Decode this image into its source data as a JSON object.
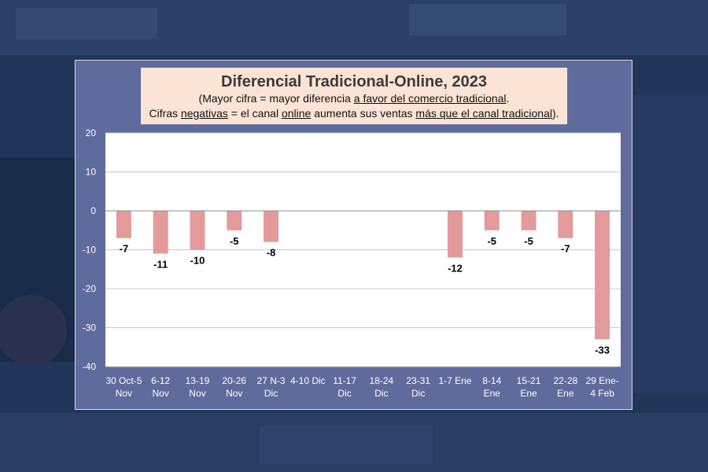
{
  "chart_data": {
    "type": "bar",
    "title": "Diferencial Tradicional-Online, 2023",
    "subtitle_line1": [
      {
        "t": "(Mayor cifra = mayor diferencia ",
        "u": false
      },
      {
        "t": "a favor del comercio tradicional",
        "u": true
      },
      {
        "t": ".",
        "u": false
      }
    ],
    "subtitle_line2": [
      {
        "t": "Cifras ",
        "u": false
      },
      {
        "t": "negativas",
        "u": true
      },
      {
        "t": " = el canal ",
        "u": false
      },
      {
        "t": "online",
        "u": true
      },
      {
        "t": " aumenta sus ventas ",
        "u": false
      },
      {
        "t": "más que el canal tradicional",
        "u": true
      },
      {
        "t": ").",
        "u": false
      }
    ],
    "categories": [
      [
        "30 Oct-5",
        "Nov"
      ],
      [
        "6-12",
        "Nov"
      ],
      [
        "13-19",
        "Nov"
      ],
      [
        "20-26",
        "Nov"
      ],
      [
        "27 N-3",
        "Dic"
      ],
      [
        "4-10 Dic"
      ],
      [
        "11-17",
        "Dic"
      ],
      [
        "18-24",
        "Dic"
      ],
      [
        "23-31",
        "Dic"
      ],
      [
        "1-7 Ene"
      ],
      [
        "8-14",
        "Ene"
      ],
      [
        "15-21",
        "Ene"
      ],
      [
        "22-28",
        "Ene"
      ],
      [
        "29 Ene-",
        "4 Feb"
      ]
    ],
    "values": [
      -7,
      -11,
      -10,
      -5,
      -8,
      null,
      null,
      null,
      null,
      -12,
      -5,
      -5,
      -7,
      -33
    ],
    "ylim": [
      -40,
      20
    ],
    "yticks": [
      20,
      10,
      0,
      -10,
      -20,
      -30,
      -40
    ],
    "grid": true,
    "bar_color": "#e39a9b",
    "plot_bg": "#ffffff",
    "panel_bg": "#5f6b9c"
  }
}
